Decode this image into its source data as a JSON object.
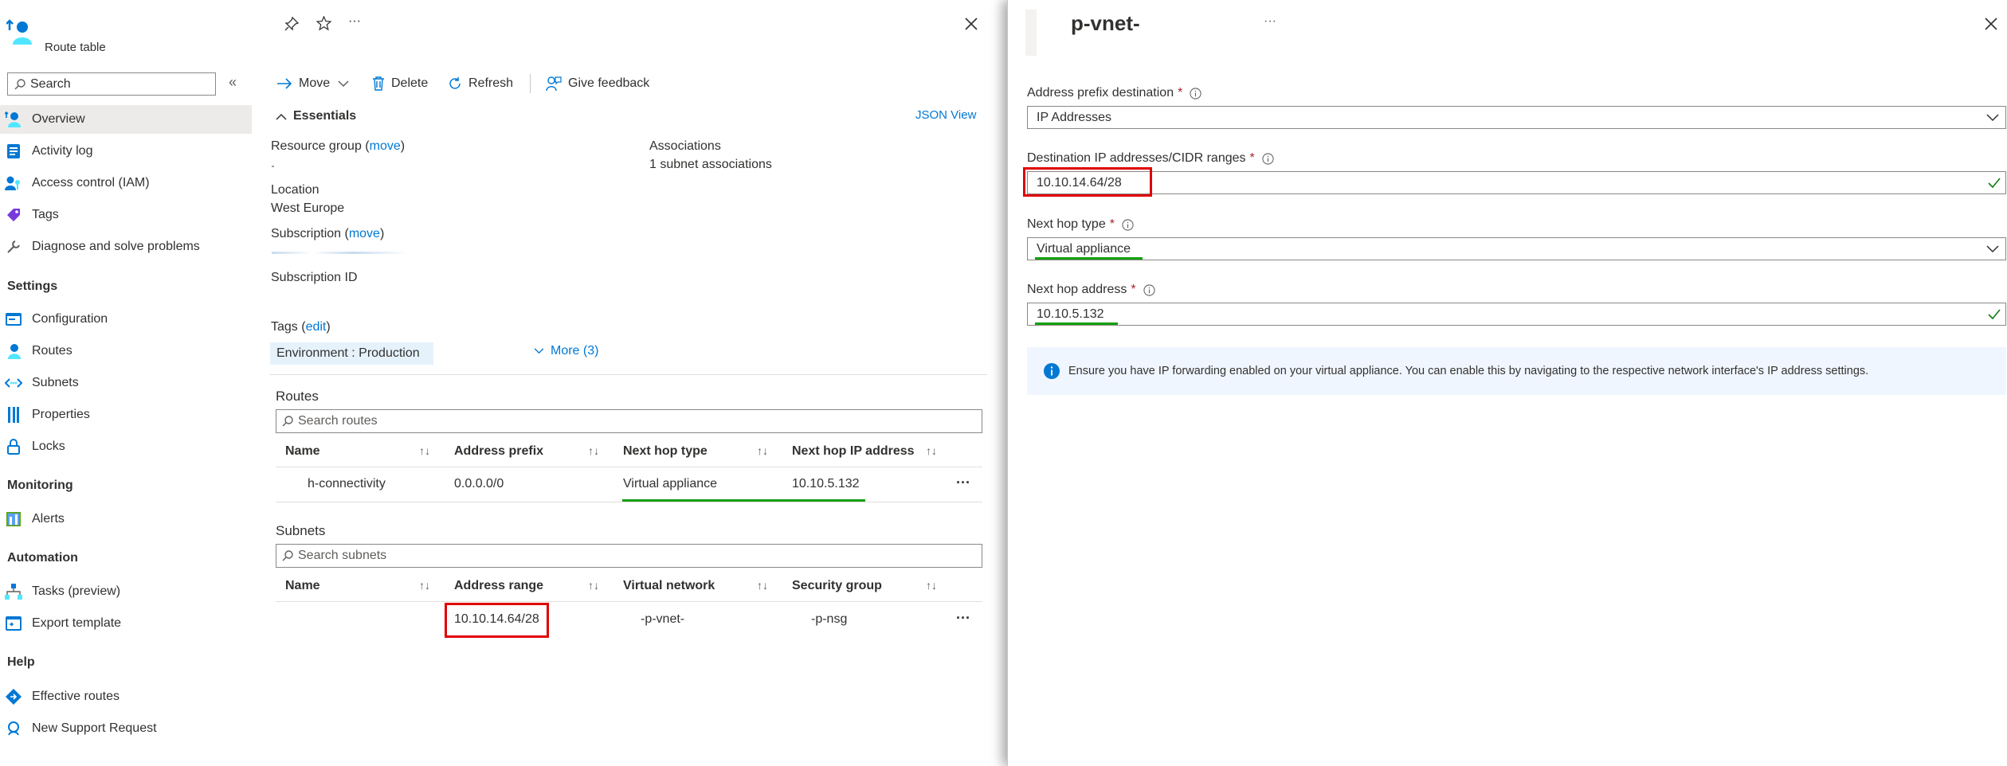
{
  "blade": {
    "title": "Route table",
    "search_placeholder": "Search",
    "collapse_glyph": "«"
  },
  "nav": {
    "items_top": [
      {
        "label": "Overview",
        "icon": "overview-icon",
        "selected": true
      },
      {
        "label": "Activity log",
        "icon": "activity-log-icon"
      },
      {
        "label": "Access control (IAM)",
        "icon": "iam-icon"
      },
      {
        "label": "Tags",
        "icon": "tag-icon"
      },
      {
        "label": "Diagnose and solve problems",
        "icon": "wrench-icon"
      }
    ],
    "settings_header": "Settings",
    "settings": [
      {
        "label": "Configuration",
        "icon": "configuration-icon"
      },
      {
        "label": "Routes",
        "icon": "routes-icon"
      },
      {
        "label": "Subnets",
        "icon": "subnets-icon"
      },
      {
        "label": "Properties",
        "icon": "properties-icon"
      },
      {
        "label": "Locks",
        "icon": "lock-icon"
      }
    ],
    "monitoring_header": "Monitoring",
    "monitoring": [
      {
        "label": "Alerts",
        "icon": "alerts-icon"
      }
    ],
    "automation_header": "Automation",
    "automation": [
      {
        "label": "Tasks (preview)",
        "icon": "tasks-icon"
      },
      {
        "label": "Export template",
        "icon": "export-template-icon"
      }
    ],
    "help_header": "Help",
    "help": [
      {
        "label": "Effective routes",
        "icon": "effective-routes-icon"
      },
      {
        "label": "New Support Request",
        "icon": "support-icon"
      }
    ]
  },
  "toolbar": {
    "move": "Move",
    "delete": "Delete",
    "refresh": "Refresh",
    "feedback": "Give feedback",
    "more": "···"
  },
  "essentials": {
    "header": "Essentials",
    "json_view": "JSON View",
    "resource_group_label": "Resource group",
    "move_link": "move",
    "location_label": "Location",
    "location_value": "West Europe",
    "subscription_label": "Subscription",
    "subscription_id_label": "Subscription ID",
    "associations_label": "Associations",
    "associations_value": "1 subnet associations",
    "tags_label": "Tags",
    "edit_link": "edit",
    "tag_value": "Environment : Production",
    "more_tags": "More (3)"
  },
  "routes": {
    "title": "Routes",
    "search_placeholder": "Search routes",
    "columns": [
      "Name",
      "Address prefix",
      "Next hop type",
      "Next hop IP address"
    ],
    "rows": [
      {
        "name": "h-connectivity",
        "prefix": "0.0.0.0/0",
        "hop_type": "Virtual appliance",
        "hop_ip": "10.10.5.132"
      }
    ]
  },
  "subnets": {
    "title": "Subnets",
    "search_placeholder": "Search subnets",
    "columns": [
      "Name",
      "Address range",
      "Virtual network",
      "Security group"
    ],
    "rows": [
      {
        "name": "",
        "range": "10.10.14.64/28",
        "vnet": "-p-vnet-",
        "nsg": "-p-nsg"
      }
    ]
  },
  "panel": {
    "title": "p-vnet-",
    "more": "···",
    "address_prefix_label": "Address prefix destination",
    "address_prefix_value": "IP Addresses",
    "destination_label": "Destination IP addresses/CIDR ranges",
    "destination_value": "10.10.14.64/28",
    "next_hop_type_label": "Next hop type",
    "next_hop_type_value": "Virtual appliance",
    "next_hop_address_label": "Next hop address",
    "next_hop_address_value": "10.10.5.132",
    "info_text": "Ensure you have IP forwarding enabled on your virtual appliance. You can enable this by navigating to the respective network interface's IP address settings."
  },
  "colors": {
    "accent": "#0078d4",
    "highlight_red": "#e00000",
    "underline_green": "#13a10e",
    "valid_check": "#107c10",
    "info_bg": "#f0f6ff"
  }
}
